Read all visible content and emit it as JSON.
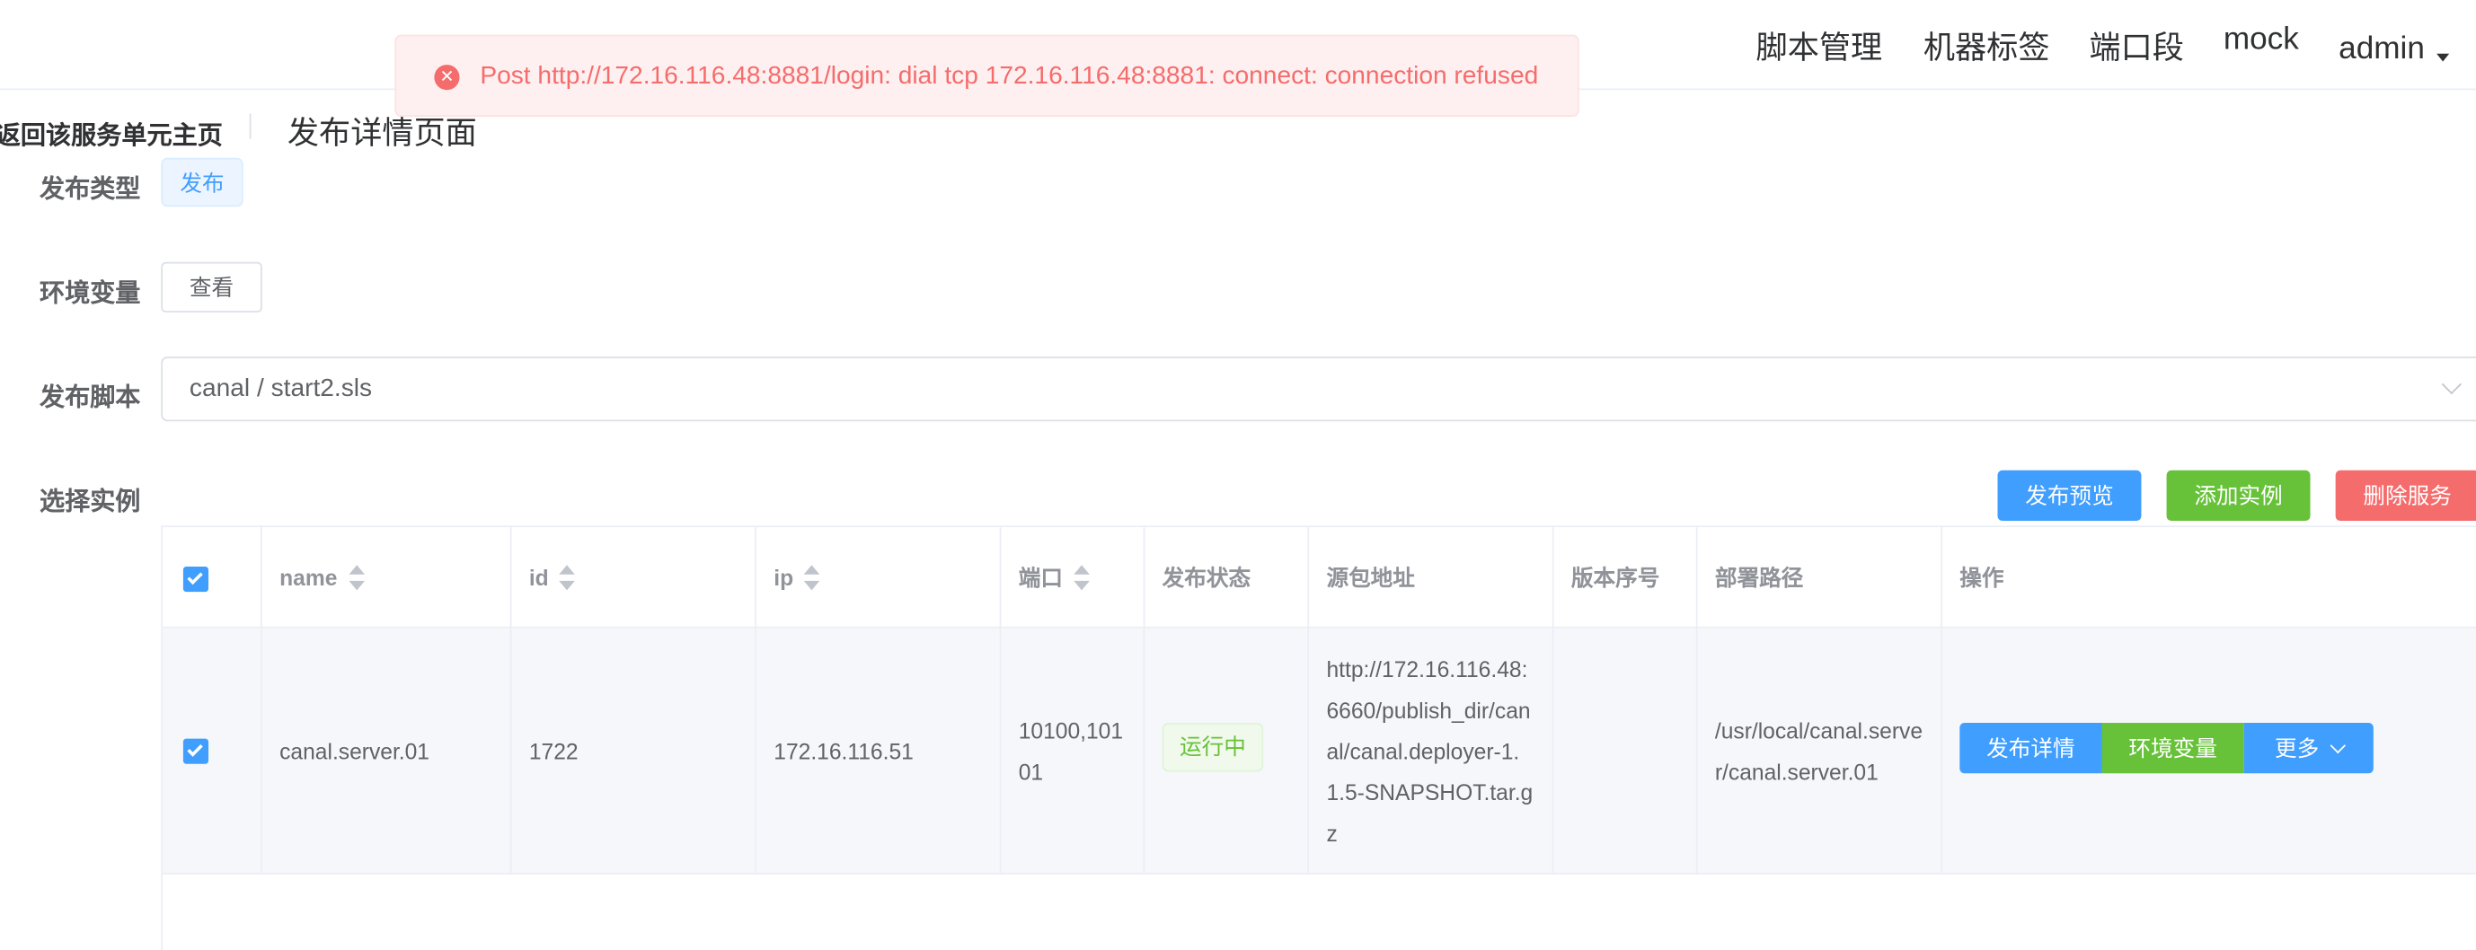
{
  "nav": {
    "items": [
      "脚本管理",
      "机器标签",
      "端口段",
      "mock"
    ],
    "user": "admin"
  },
  "toast": {
    "type": "error",
    "message": "Post http://172.16.116.48:8881/login: dial tcp 172.16.116.48:8881: connect: connection refused"
  },
  "page_header": {
    "back_label": "返回该服务单元主页",
    "title": "发布详情页面"
  },
  "form": {
    "publish_type_label": "发布类型",
    "publish_type_value": "发布",
    "env_label": "环境变量",
    "env_button": "查看",
    "script_label": "发布脚本",
    "script_value": "canal / start2.sls",
    "instances_label": "选择实例"
  },
  "actions": {
    "preview": "发布预览",
    "add_instance": "添加实例",
    "delete_service": "删除服务"
  },
  "table": {
    "columns": [
      "name",
      "id",
      "ip",
      "端口",
      "发布状态",
      "源包地址",
      "版本序号",
      "部署路径",
      "操作"
    ],
    "rows": [
      {
        "name": "canal.server.01",
        "id": "1722",
        "ip": "172.16.116.51",
        "port": "10100,10101",
        "status": "运行中",
        "source": "http://172.16.116.48:6660/publish_dir/canal/canal.deployer-1.1.5-SNAPSHOT.tar.gz",
        "version": "",
        "deploy_path": "/usr/local/canal.server/canal.server.01",
        "ops": {
          "detail": "发布详情",
          "env": "环境变量",
          "more": "更多"
        }
      }
    ]
  },
  "colors": {
    "primary": "#409eff",
    "success": "#67c23a",
    "danger": "#f56c6c"
  }
}
